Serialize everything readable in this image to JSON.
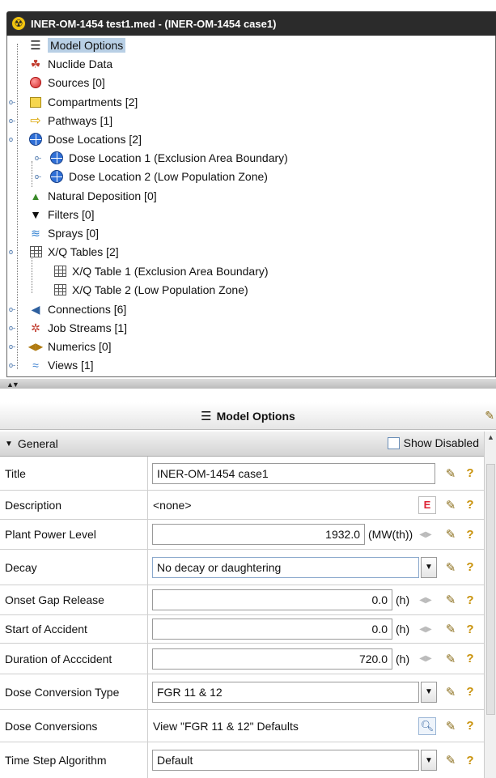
{
  "window": {
    "title": "INER-OM-1454 test1.med - (INER-OM-1454 case1)"
  },
  "tree": {
    "items": [
      {
        "label": "Model Options",
        "icon": "model-options-icon"
      },
      {
        "label": "Nuclide Data",
        "icon": "nuclide-icon"
      },
      {
        "label": "Sources [0]",
        "icon": "sphere-icon"
      },
      {
        "label": "Compartments [2]",
        "icon": "box-icon"
      },
      {
        "label": "Pathways [1]",
        "icon": "arrow-icon"
      },
      {
        "label": "Dose Locations [2]",
        "icon": "globe-icon"
      },
      {
        "label": "Dose Location 1 (Exclusion Area Boundary)",
        "icon": "globe-icon"
      },
      {
        "label": "Dose Location 2 (Low Population Zone)",
        "icon": "globe-icon"
      },
      {
        "label": "Natural Deposition [0]",
        "icon": "drop-icon"
      },
      {
        "label": "Filters [0]",
        "icon": "filter-icon"
      },
      {
        "label": "Sprays [0]",
        "icon": "spray-icon"
      },
      {
        "label": "X/Q Tables [2]",
        "icon": "table-icon"
      },
      {
        "label": "X/Q Table 1 (Exclusion Area Boundary)",
        "icon": "table-icon"
      },
      {
        "label": "X/Q Table 2 (Low Population Zone)",
        "icon": "table-icon"
      },
      {
        "label": "Connections [6]",
        "icon": "connection-icon"
      },
      {
        "label": "Job Streams [1]",
        "icon": "job-stream-icon"
      },
      {
        "label": "Numerics [0]",
        "icon": "numerics-icon"
      },
      {
        "label": "Views [1]",
        "icon": "views-icon"
      }
    ]
  },
  "panel": {
    "title": "Model Options",
    "section": "General",
    "show_disabled": "Show Disabled",
    "rows": [
      {
        "label": "Title",
        "value": "INER-OM-1454 case1"
      },
      {
        "label": "Description",
        "value": "<none>"
      },
      {
        "label": "Plant Power Level",
        "value": "1932.0",
        "unit": "(MW(th))"
      },
      {
        "label": "Decay",
        "value": "No decay or daughtering"
      },
      {
        "label": "Onset Gap Release",
        "value": "0.0",
        "unit": "(h)"
      },
      {
        "label": "Start of Accident",
        "value": "0.0",
        "unit": "(h)"
      },
      {
        "label": "Duration of Acccident",
        "value": "720.0",
        "unit": "(h)"
      },
      {
        "label": "Dose Conversion Type",
        "value": "FGR 11 & 12"
      },
      {
        "label": "Dose Conversions",
        "value": "View \"FGR 11 & 12\" Defaults"
      },
      {
        "label": "Time Step Algorithm",
        "value": "Default"
      }
    ]
  },
  "colors": {
    "selection": "#b8cfe5",
    "titlebar": "#2b2b2b"
  }
}
